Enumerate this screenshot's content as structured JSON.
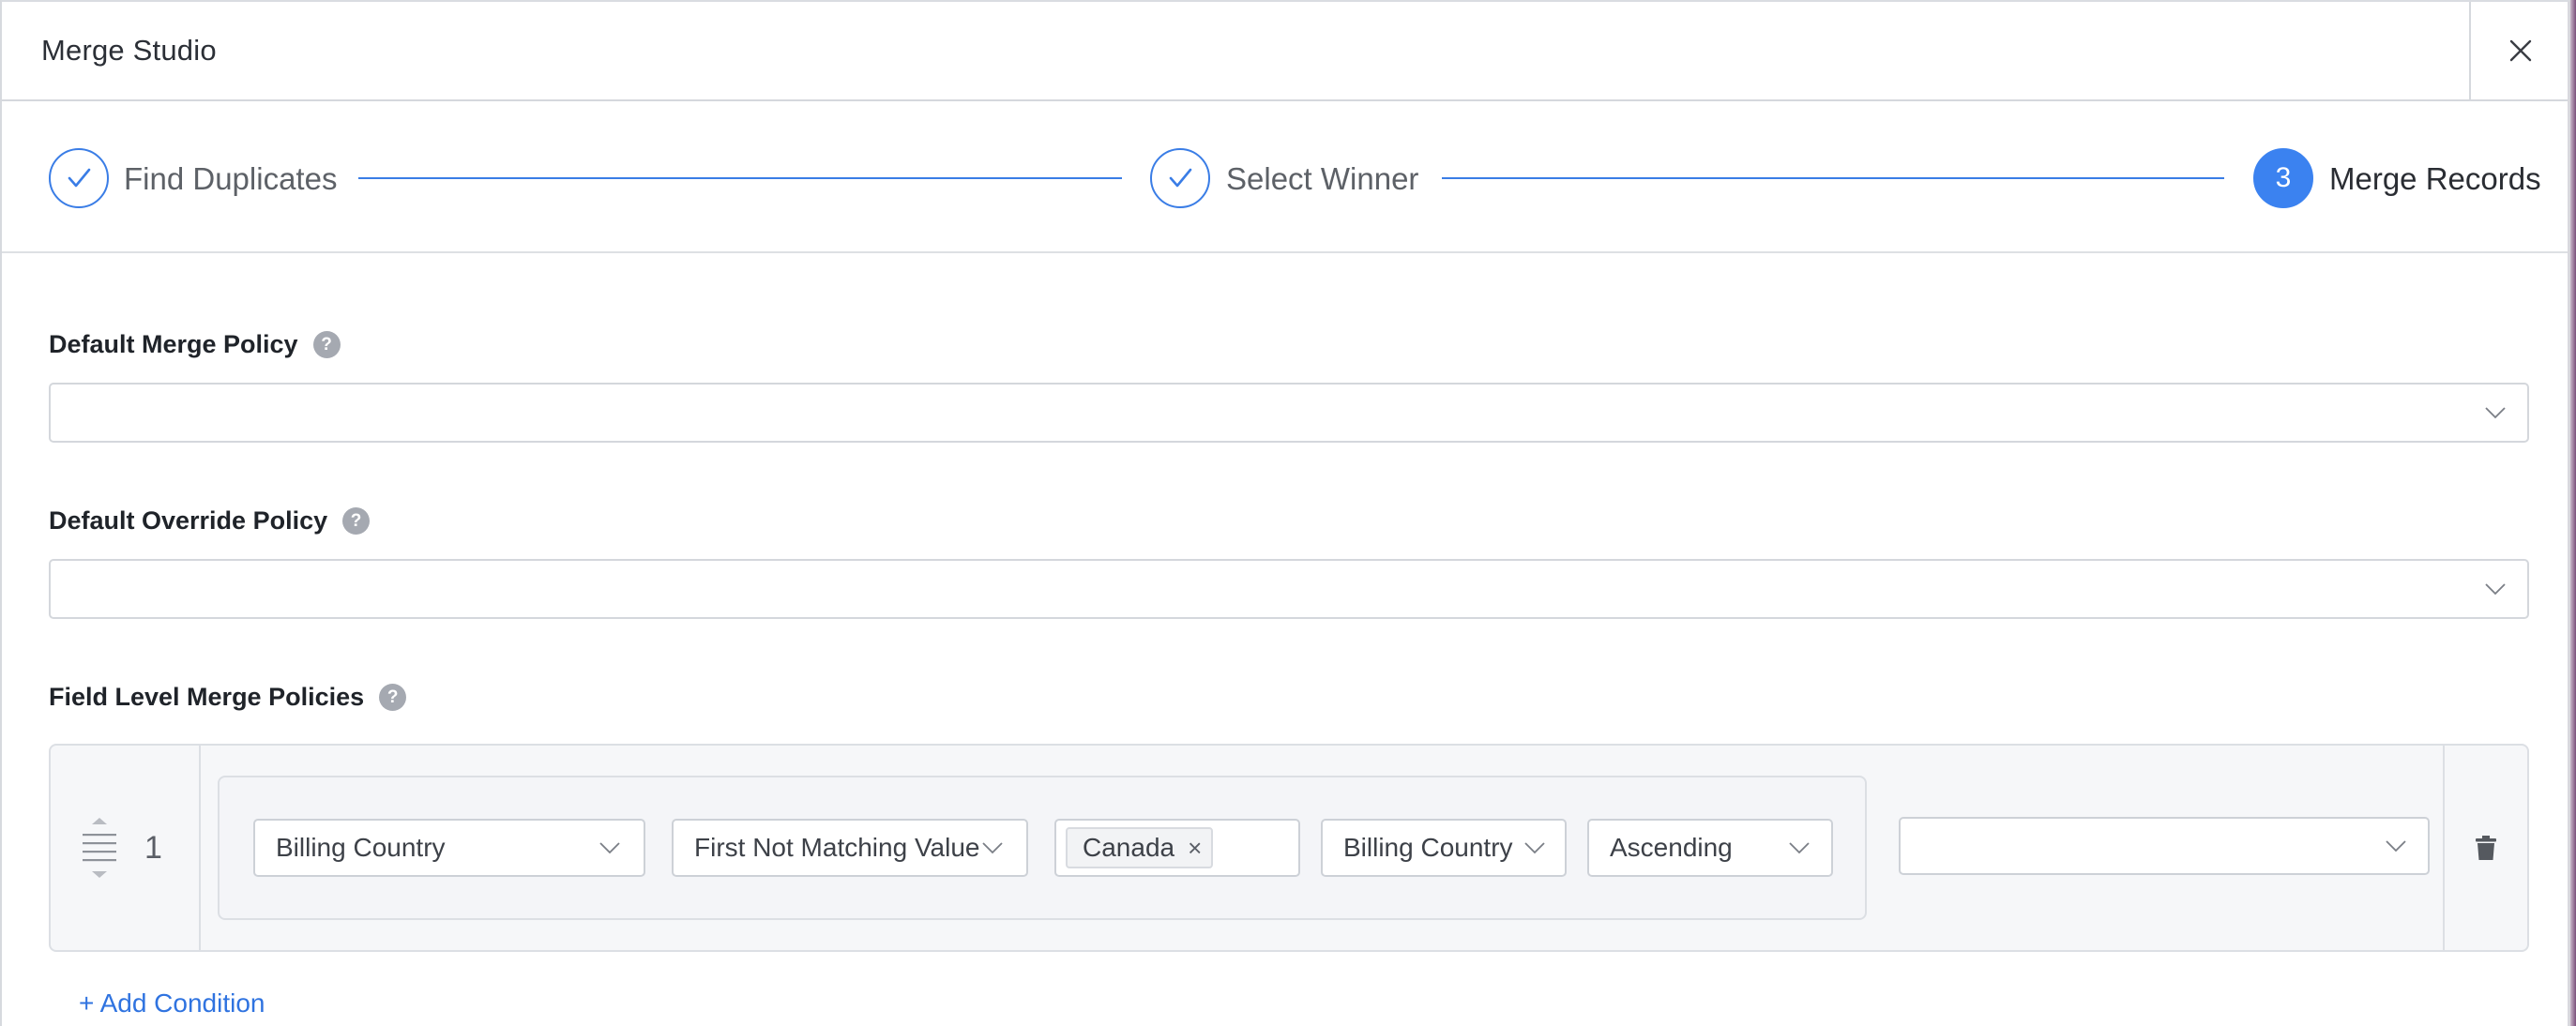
{
  "header": {
    "title": "Merge Studio",
    "close_icon": "close-icon"
  },
  "stepper": {
    "steps": [
      {
        "label": "Find Duplicates",
        "state": "complete",
        "icon": "check-icon"
      },
      {
        "label": "Select Winner",
        "state": "complete",
        "icon": "check-icon"
      },
      {
        "label": "Merge Records",
        "state": "active",
        "number": "3"
      }
    ]
  },
  "default_merge_policy": {
    "label": "Default Merge Policy",
    "help": "?",
    "value": ""
  },
  "default_override_policy": {
    "label": "Default Override Policy",
    "help": "?",
    "value": ""
  },
  "field_level": {
    "label": "Field Level Merge Policies",
    "help": "?",
    "rows": [
      {
        "index": "1",
        "field": "Billing Country",
        "policy": "First Not Matching Value",
        "tag": "Canada",
        "tag_remove": "×",
        "sort_field": "Billing Country",
        "sort_order": "Ascending",
        "extra": ""
      }
    ],
    "add_condition": "+ Add Condition"
  },
  "colors": {
    "accent": "#3b82f0",
    "link": "#2f73e0",
    "border": "#d4d7dc",
    "help_icon_bg": "#a5a9b1"
  }
}
